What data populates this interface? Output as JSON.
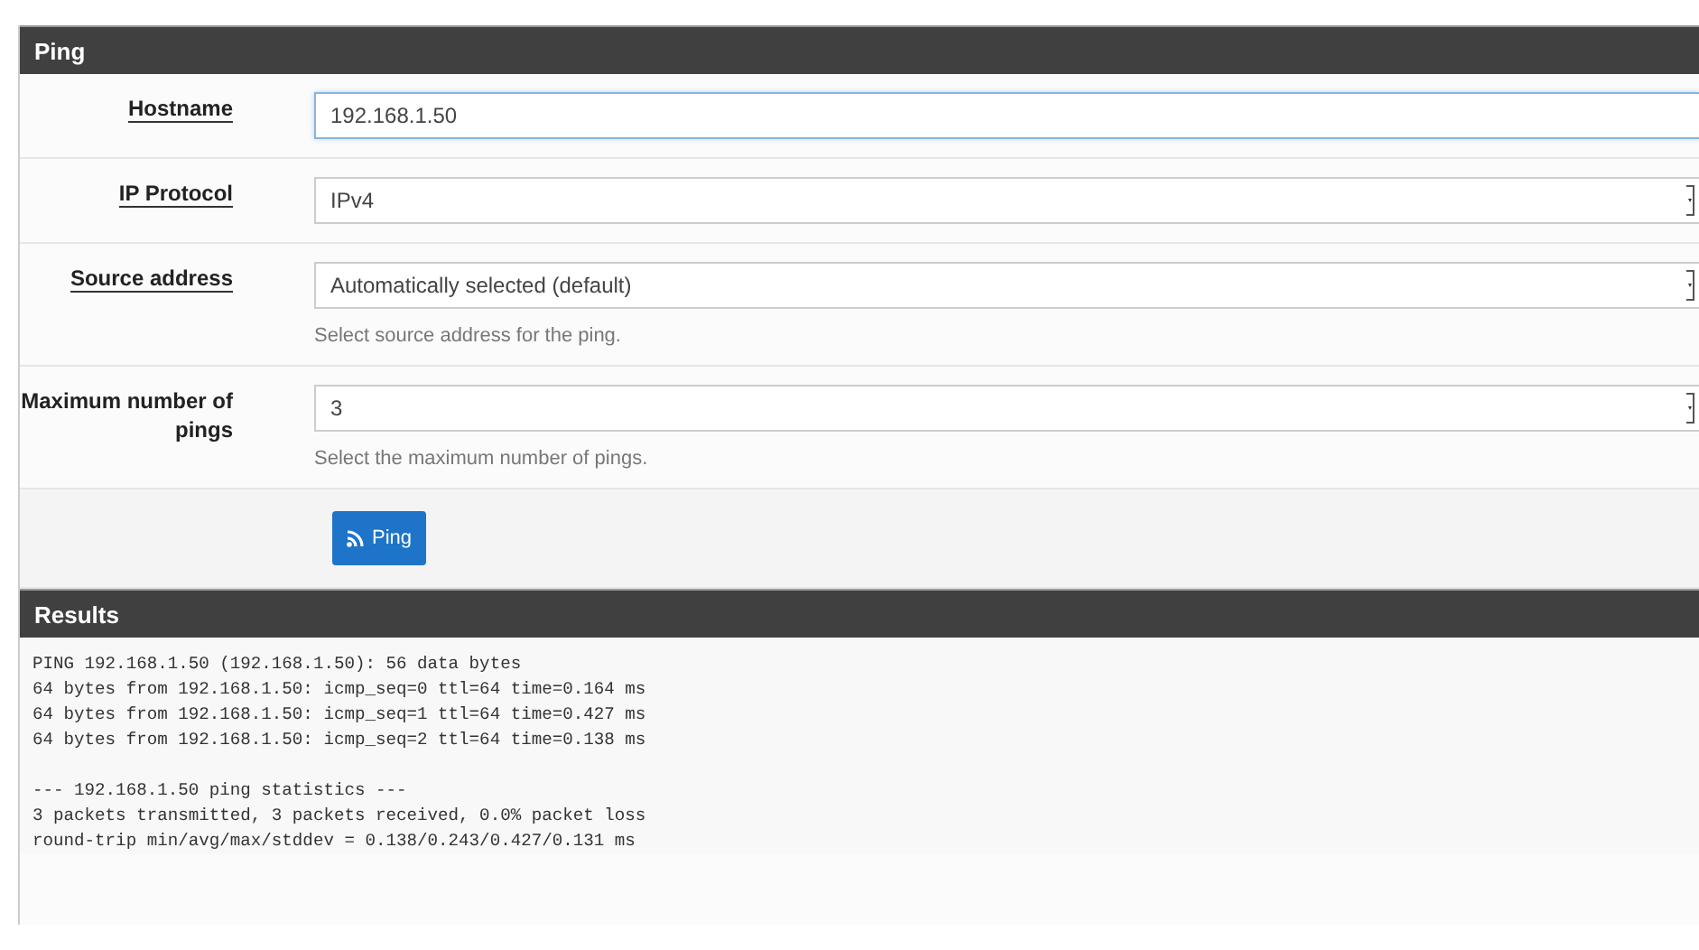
{
  "ping_panel": {
    "title": "Ping",
    "fields": [
      {
        "kind": "input",
        "label": "Hostname",
        "value": "192.168.1.50",
        "focused": true
      },
      {
        "kind": "select",
        "label": "IP Protocol",
        "value": "IPv4",
        "focused": false
      },
      {
        "kind": "select",
        "label": "Source address",
        "value": "Automatically selected (default)",
        "help": "Select source address for the ping.",
        "focused": false
      },
      {
        "kind": "select",
        "label": "Maximum number of pings",
        "value": "3",
        "help": "Select the maximum number of pings.",
        "focused": false
      }
    ],
    "button": {
      "label": "Ping"
    }
  },
  "results_panel": {
    "title": "Results",
    "blocks": [
      [
        "PING 192.168.1.50 (192.168.1.50): 56 data bytes",
        "64 bytes from 192.168.1.50: icmp_seq=0 ttl=64 time=0.164 ms",
        "64 bytes from 192.168.1.50: icmp_seq=1 ttl=64 time=0.427 ms",
        "64 bytes from 192.168.1.50: icmp_seq=2 ttl=64 time=0.138 ms"
      ],
      [
        "--- 192.168.1.50 ping statistics ---",
        "3 packets transmitted, 3 packets received, 0.0% packet loss",
        "round-trip min/avg/max/stddev = 0.138/0.243/0.427/0.131 ms"
      ]
    ]
  }
}
